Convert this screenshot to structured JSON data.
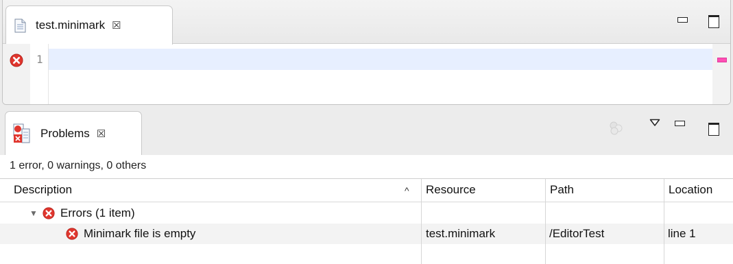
{
  "editor": {
    "tab_label": "test.minimark",
    "close_glyph": "☒",
    "line_number": "1"
  },
  "problems": {
    "tab_label": "Problems",
    "close_glyph": "☒",
    "summary": "1 error, 0 warnings, 0 others",
    "columns": {
      "description": "Description",
      "sort_indicator": "^",
      "resource": "Resource",
      "path": "Path",
      "location": "Location"
    },
    "group": {
      "expander": "▼",
      "label": "Errors (1 item)"
    },
    "item": {
      "description": "Minimark file is empty",
      "resource": "test.minimark",
      "path": "/EditorTest",
      "location": "line 1"
    }
  },
  "colors": {
    "error_red": "#e0362e",
    "current_line": "#e7efff",
    "overview_mark": "#ff4fb4"
  }
}
